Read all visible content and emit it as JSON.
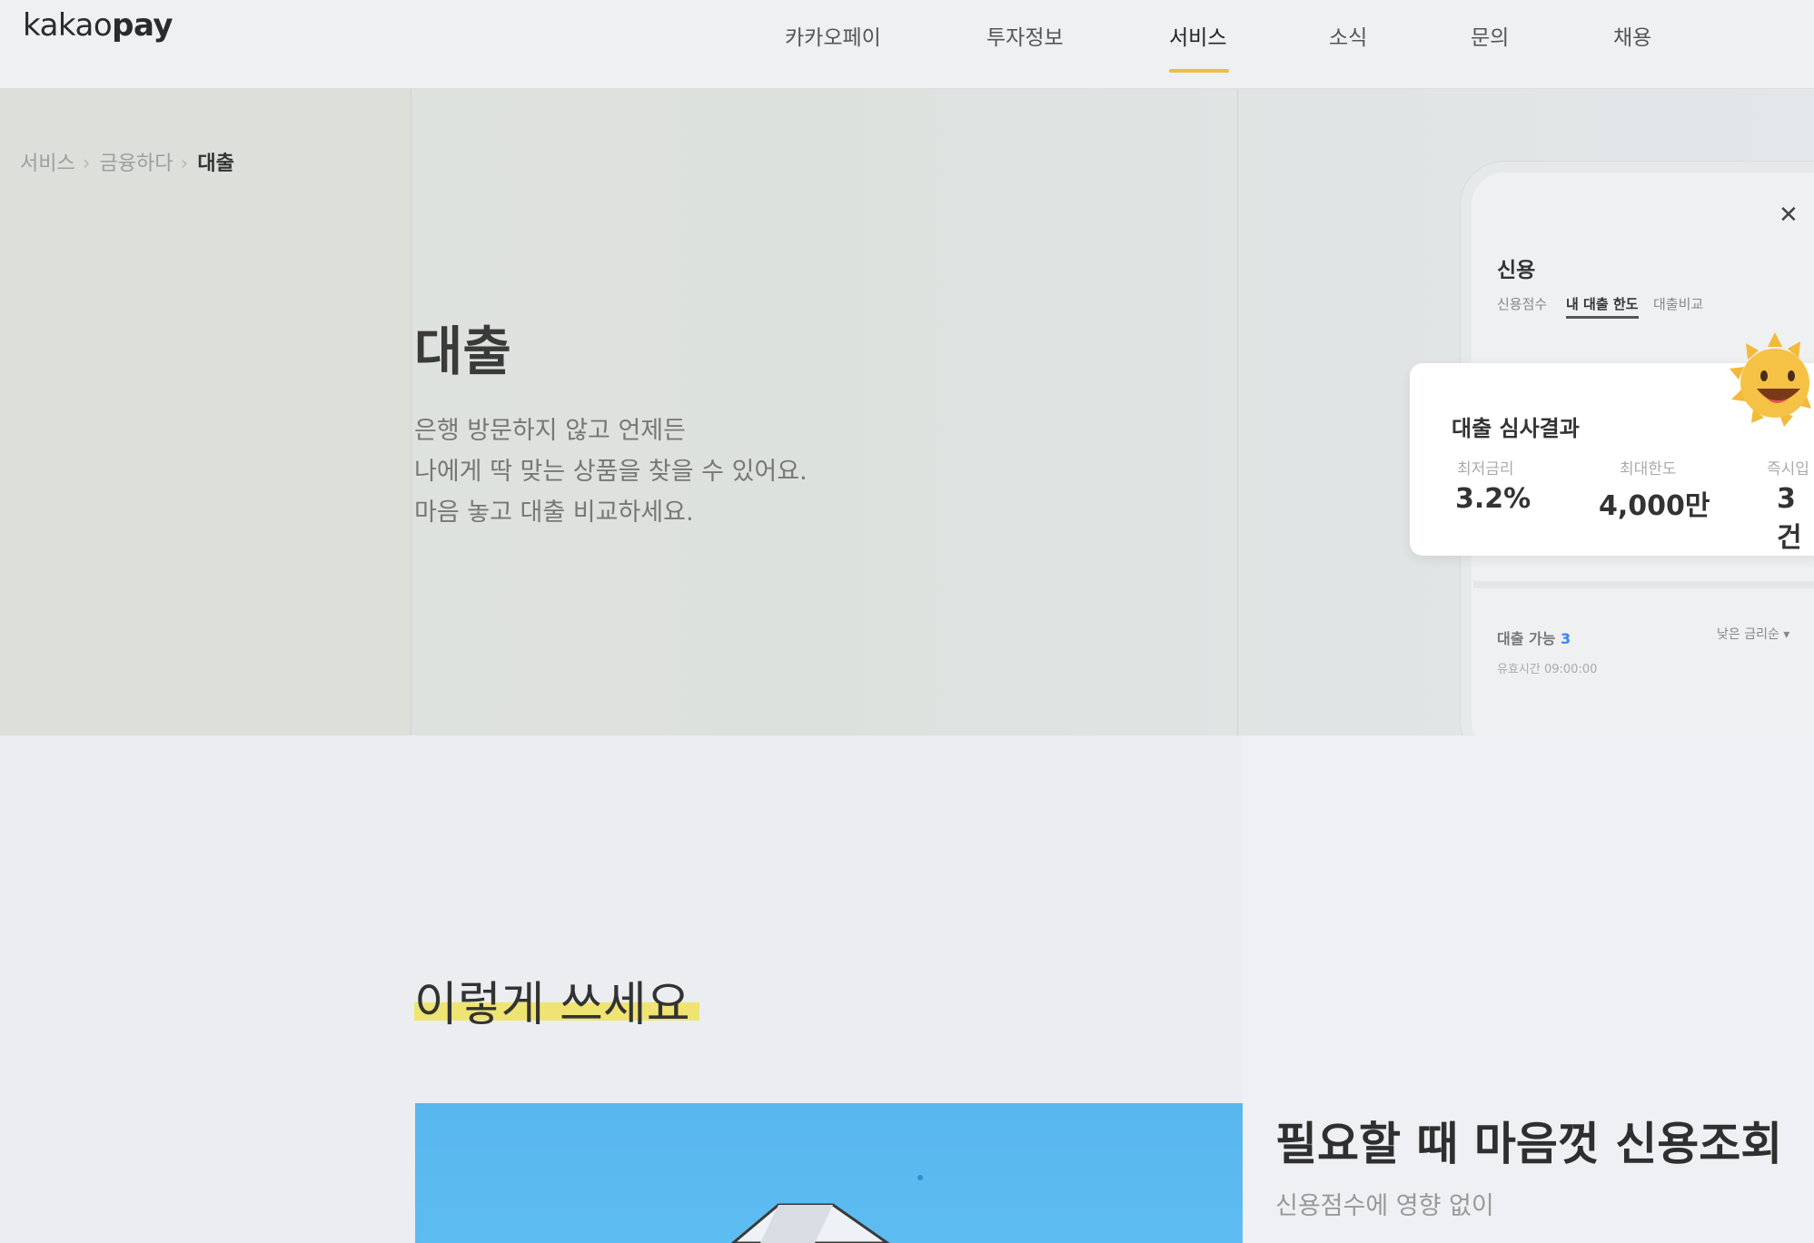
{
  "header": {
    "logo_light": "kakao",
    "logo_bold": "pay",
    "nav": [
      "카카오페이",
      "투자정보",
      "서비스",
      "소식",
      "문의",
      "채용"
    ],
    "active_nav": "서비스"
  },
  "breadcrumb": [
    "서비스",
    "금융하다",
    "대출"
  ],
  "hero": {
    "title": "대출",
    "desc_lines": [
      "은행 방문하지 않고 언제든",
      "나에게 딱 맞는 상품을 찾을 수 있어요.",
      "마음 놓고 대출 비교하세요."
    ]
  },
  "phone": {
    "close": "✕",
    "title": "신용",
    "tabs": [
      "신용점수",
      "내 대출 한도",
      "대출비교"
    ],
    "active_tab": "내 대출 한도",
    "result_card": {
      "title": "대출 심사결과",
      "labels": [
        "최저금리",
        "최대한도",
        "즉시입"
      ],
      "values": [
        "3.2%",
        "4,000만",
        "3건"
      ]
    },
    "available_label": "대출 가능",
    "available_count": "3",
    "valid_time": "유효시간 09:00:00",
    "sort": "낮은 금리순 ▾"
  },
  "section": {
    "title": "이렇게 쓰세요",
    "feature_title": "필요할 때 마음껏 신용조회",
    "feature_sub": "신용점수에 영향 없이"
  },
  "colors": {
    "accent_underline": "#f0b94a",
    "highlight": "#efe472",
    "blue_card": "#58b7ee"
  }
}
